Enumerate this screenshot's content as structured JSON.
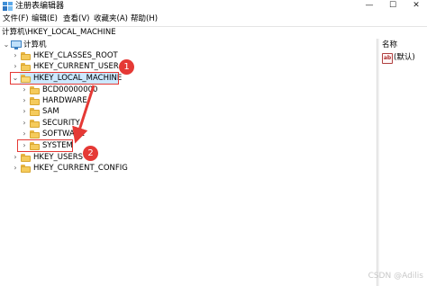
{
  "window": {
    "title": "注册表编辑器",
    "controls": [
      "—",
      "☐",
      "✕"
    ]
  },
  "menu": [
    "文件(F)",
    "编辑(E)",
    "查看(V)",
    "收藏夹(A)",
    "帮助(H)"
  ],
  "address": "计算机\\HKEY_LOCAL_MACHINE",
  "tree": {
    "root": "计算机",
    "hives": {
      "classes_root": "HKEY_CLASSES_ROOT",
      "current_user": "HKEY_CURRENT_USER",
      "local_machine": "HKEY_LOCAL_MACHINE",
      "users": "HKEY_USERS",
      "current_config": "HKEY_CURRENT_CONFIG"
    },
    "local_machine_children": [
      "BCD00000000",
      "HARDWARE",
      "SAM",
      "SECURITY",
      "SOFTWARE",
      "SYSTEM"
    ]
  },
  "right_pane": {
    "column_header": "名称",
    "value_icon": "ab",
    "value_name": "(默认)"
  },
  "annotations": {
    "badge1": "1",
    "badge2": "2",
    "color": "#e53935"
  },
  "watermark": "CSDN @Adilis"
}
